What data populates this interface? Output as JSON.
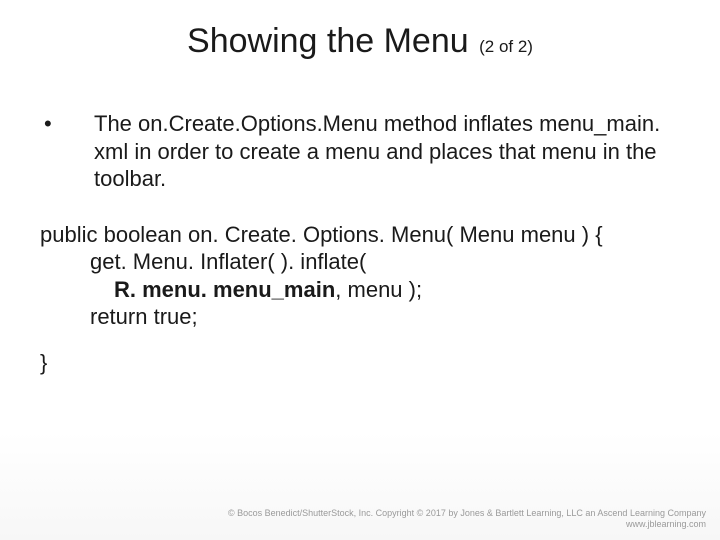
{
  "title": {
    "main": "Showing the Menu",
    "sub": "(2 of 2)"
  },
  "bullet": {
    "mark": "•",
    "text": "The on.Create.Options.Menu method inflates menu_main. xml in order to create a menu and places that menu in the toolbar."
  },
  "code": {
    "l1": "public boolean on. Create. Options. Menu( Menu menu ) {",
    "l2": "get. Menu. Inflater( ). inflate(",
    "l3a": "R. menu. menu_main",
    "l3b": ", menu );",
    "l4": "return true;",
    "l5": "}"
  },
  "footer": {
    "line1": "© Bocos Benedict/ShutterStock, Inc. Copyright © 2017 by Jones & Bartlett Learning, LLC an Ascend Learning Company",
    "line2": "www.jblearning.com"
  }
}
